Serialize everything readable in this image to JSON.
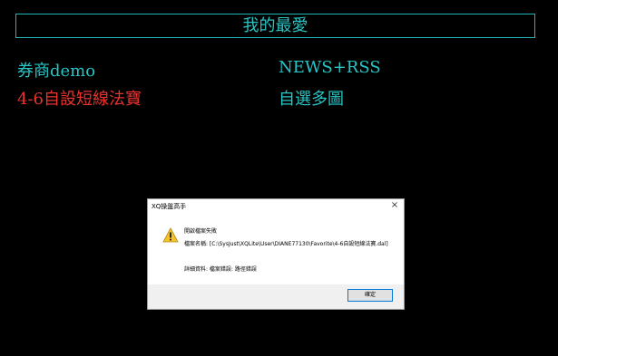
{
  "page": {
    "title": "我的最愛"
  },
  "favorites": [
    {
      "label": "券商demo",
      "color": "#27c5c5"
    },
    {
      "label": "NEWS+RSS",
      "color": "#27c5c5"
    },
    {
      "label": "4-6自設短線法寶",
      "color": "#e8332f"
    },
    {
      "label": "自選多圖",
      "color": "#27c5c5"
    }
  ],
  "dialog": {
    "title": "XQ操盤高手",
    "close": "×",
    "heading": "開啟檔案失敗",
    "body": "檔案名稱: [C:\\SysJust\\XQLite\\User\\DIANE77130\\Favorite\\4-6自設短線法寶.dal]",
    "detail": "詳細資料: 檔案錯誤: 路徑錯誤",
    "ok_label": "確定",
    "icon": "warning-icon"
  }
}
